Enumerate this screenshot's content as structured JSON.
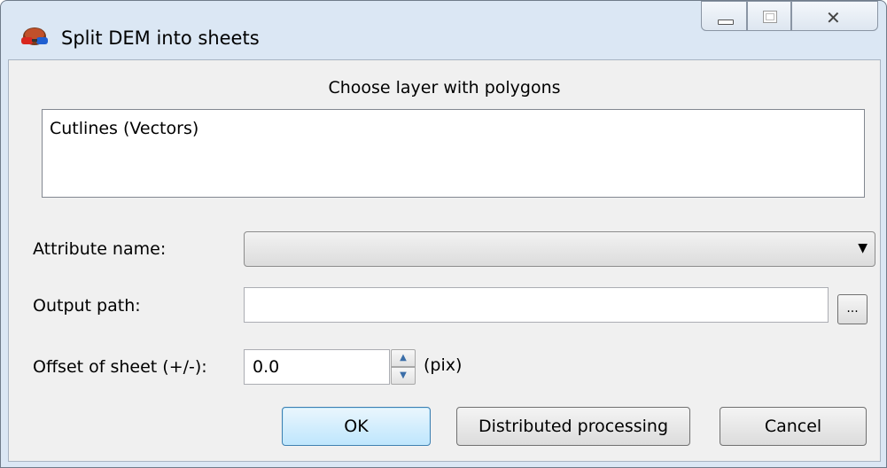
{
  "window": {
    "title": "Split DEM into sheets",
    "icon": "3d-glasses-icon",
    "controls": {
      "minimize": "minimize-icon",
      "maximize": "maximize-icon",
      "close": "close-icon"
    }
  },
  "layers": {
    "heading": "Choose layer with polygons",
    "items": [
      {
        "label": "Cutlines (Vectors)"
      }
    ]
  },
  "form": {
    "attribute_label": "Attribute name:",
    "attribute_value": "",
    "output_label": "Output path:",
    "output_value": "",
    "browse_label": "...",
    "offset_label": "Offset of sheet (+/-):",
    "offset_value": "0.0",
    "offset_unit": "(pix)"
  },
  "buttons": {
    "ok": "OK",
    "distributed": "Distributed processing",
    "cancel": "Cancel"
  },
  "colors": {
    "frame": "#dbe7f4",
    "client": "#f0f0f0",
    "default_button": "#bee6fd"
  }
}
